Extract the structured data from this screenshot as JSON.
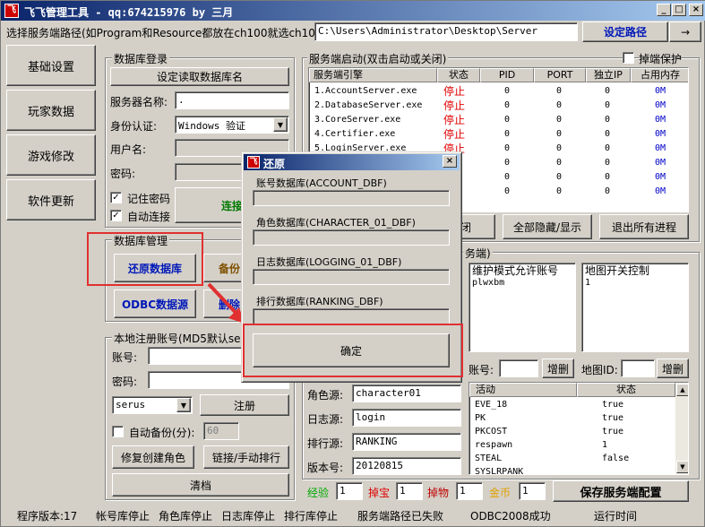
{
  "window": {
    "title": "飞飞管理工具  - qq:674215976    by 三月",
    "icon_label": "飞"
  },
  "path_bar": {
    "label": "选择服务端路径(如Program和Resource都放在ch100就选ch100):",
    "value": "C:\\Users\\Administrator\\Desktop\\Server",
    "set_button": "设定路径",
    "arrow_button": "→"
  },
  "sidebar": {
    "items": [
      {
        "label": "基础设置"
      },
      {
        "label": "玩家数据"
      },
      {
        "label": "游戏修改"
      },
      {
        "label": "软件更新"
      }
    ]
  },
  "db_login": {
    "group_label": "数据库登录",
    "read_button": "设定读取数据库名",
    "server_label": "服务器名称:",
    "server_value": ".",
    "auth_label": "身份认证:",
    "auth_value": "Windows 验证",
    "user_label": "用户名:",
    "password_label": "密码:",
    "remember_label": "记住密码",
    "auto_connect_label": "自动连接",
    "connect_button": "连接"
  },
  "db_manage": {
    "group_label": "数据库管理",
    "restore_button": "还原数据库",
    "backup_button": "备份",
    "odbc_button": "ODBC数据源",
    "delete_button": "删除"
  },
  "local_register": {
    "group_label": "本地注册账号(MD5默认serus)",
    "account_label": "账号:",
    "password_label": "密码:",
    "select_value": "serus",
    "register_button": "注册",
    "auto_backup_label": "自动备份(分):",
    "auto_backup_value": "60",
    "fix_role_button": "修复创建角色",
    "link_button": "链接/手动排行",
    "clear_button": "清档"
  },
  "server_start": {
    "group_label": "服务端启动(双击启动或关闭)",
    "protect_label": "掉端保护",
    "headers": [
      "服务端引擎",
      "状态",
      "PID",
      "PORT",
      "独立IP",
      "占用内存"
    ],
    "rows": [
      {
        "name": "1.AccountServer.exe",
        "status": "停止",
        "pid": "0",
        "port": "0",
        "ip": "0",
        "mem": "0M"
      },
      {
        "name": "2.DatabaseServer.exe",
        "status": "停止",
        "pid": "0",
        "port": "0",
        "ip": "0",
        "mem": "0M"
      },
      {
        "name": "3.CoreServer.exe",
        "status": "停止",
        "pid": "0",
        "port": "0",
        "ip": "0",
        "mem": "0M"
      },
      {
        "name": "4.Certifier.exe",
        "status": "停止",
        "pid": "0",
        "port": "0",
        "ip": "0",
        "mem": "0M"
      },
      {
        "name": "5.LoginServer.exe",
        "status": "停止",
        "pid": "0",
        "port": "0",
        "ip": "0",
        "mem": "0M"
      },
      {
        "name": "",
        "status": "",
        "pid": "0",
        "port": "0",
        "ip": "0",
        "mem": "0M"
      },
      {
        "name": "",
        "status": "",
        "pid": "0",
        "port": "0",
        "ip": "0",
        "mem": "0M"
      },
      {
        "name": "",
        "status": "",
        "pid": "0",
        "port": "0",
        "ip": "0",
        "mem": "0M"
      }
    ],
    "partial_button": "闭",
    "hide_show_button": "全部隐藏/显示",
    "exit_all_button": "退出所有进程"
  },
  "server_settings": {
    "group_label_tail": "务端)",
    "maint_header": "维护模式允许账号",
    "maint_value": "plwxbm",
    "map_header": "地图开关控制",
    "map_value": "1",
    "account_label": "账号:",
    "add_del_button": "增删",
    "map_id_label": "地图ID:",
    "map_add_del_button": "增删",
    "role_source_label": "角色源:",
    "role_source_value": "character01",
    "log_source_label": "日志源:",
    "log_source_value": "login",
    "rank_source_label": "排行源:",
    "rank_source_value": "RANKING",
    "version_label": "版本号:",
    "version_value": "20120815",
    "activity_headers": [
      "活动",
      "状态"
    ],
    "activities": [
      {
        "name": "EVE_18",
        "state": "true"
      },
      {
        "name": "PK",
        "state": "true"
      },
      {
        "name": "PKCOST",
        "state": "true"
      },
      {
        "name": "respawn",
        "state": "1"
      },
      {
        "name": "STEAL",
        "state": "false"
      },
      {
        "name": "SYSLRPANK",
        "state": ""
      }
    ]
  },
  "rates": {
    "exp_label": "经验",
    "exp_value": "1",
    "drop_label": "掉宝",
    "drop_value": "1",
    "item_label": "掉物",
    "item_value": "1",
    "gold_label": "金币",
    "gold_value": "1",
    "save_button": "保存服务端配置"
  },
  "dialog": {
    "title": "还原",
    "fields": [
      {
        "label": "账号数据库(ACCOUNT_DBF)"
      },
      {
        "label": "角色数据库(CHARACTER_01_DBF)"
      },
      {
        "label": "日志数据库(LOGGING_01_DBF)"
      },
      {
        "label": "排行数据库(RANKING_DBF)"
      }
    ],
    "ok_button": "确定"
  },
  "statusbar": {
    "version": "程序版本:17",
    "account_db": "帐号库停止",
    "role_db": "角色库停止",
    "log_db": "日志库停止",
    "rank_db": "排行库停止",
    "path_status": "服务端路径已失败",
    "odbc_status": "ODBC2008成功",
    "runtime": "运行时间"
  },
  "colors": {
    "highlight": "#e03030",
    "stopped": "#e00000",
    "memory": "#0000cc",
    "title_start": "#0a246a",
    "title_end": "#a6caf0"
  }
}
